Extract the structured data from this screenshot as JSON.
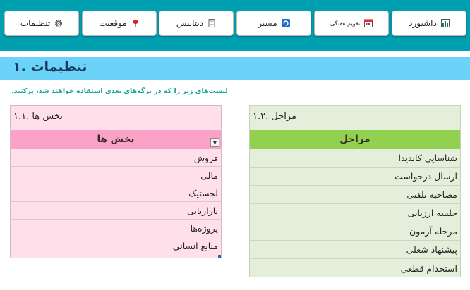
{
  "toolbar": {
    "buttons": [
      {
        "label": "داشبورد",
        "icon": "bar-chart-icon"
      },
      {
        "label": "تقویم هفتگی",
        "icon": "calendar-icon"
      },
      {
        "label": "مسیر",
        "icon": "refresh-icon"
      },
      {
        "label": "دیتابیس",
        "icon": "document-icon"
      },
      {
        "label": "موقعیت",
        "icon": "pushpin-icon"
      },
      {
        "label": "تنظیمات",
        "icon": "gear-icon"
      }
    ]
  },
  "page": {
    "title": "تنظیمات .۱",
    "subtitle": "لیست‌های زیر را که در برگه‌های بعدی استفاده خواهند شد، پرکنید."
  },
  "departments": {
    "caption": "بخش ها .۱.۱",
    "header": "بخش ها",
    "items": [
      "فروش",
      "مالی",
      "لجستیک",
      "بازاریابی",
      "پروژه‌ها",
      "منابع انسانی"
    ]
  },
  "stages": {
    "caption": "مراحل .۱.۲",
    "header": "مراحل",
    "items": [
      "شناسایی کاندیدا",
      "ارسال درخواست",
      "مصاحبه تلفنی",
      "جلسه ارزیابی",
      "مرحله آزمون",
      "پیشنهاد شغلی",
      "استخدام قطعی"
    ]
  },
  "colors": {
    "toolbar": "#00a0b0",
    "title_bar": "#6bd3f7",
    "departments_header": "#fba3c6",
    "stages_header": "#92d050"
  }
}
